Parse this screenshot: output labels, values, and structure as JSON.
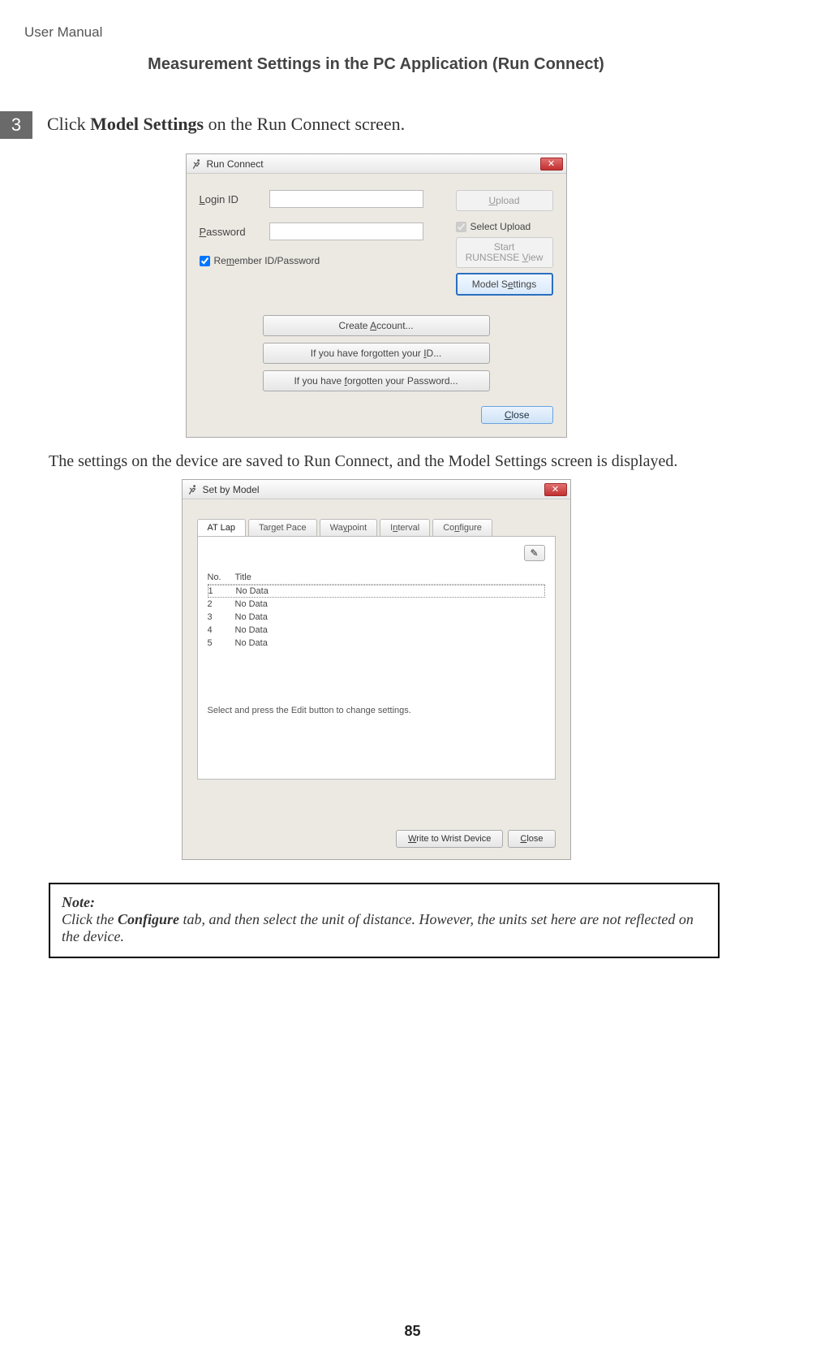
{
  "doc": {
    "header_small": "User Manual",
    "section_title": "Measurement Settings in the PC Application (Run Connect)",
    "step_number": "3",
    "step_prefix": "Click ",
    "step_bold": "Model Settings",
    "step_suffix": " on the Run Connect screen.",
    "body_text": "The settings on the device are saved to Run Connect, and the Model Settings screen is displayed.",
    "note_label": "Note:",
    "note_prefix": "Click the ",
    "note_bold": "Configure",
    "note_suffix": " tab, and then select the unit of distance. However, the units set here are not reflected on the device.",
    "page_number": "85"
  },
  "run_connect": {
    "title": "Run Connect",
    "login_label_u": "L",
    "login_label_rest": "ogin ID",
    "password_label_u": "P",
    "password_label_rest": "assword",
    "remember_pre": "Re",
    "remember_u": "m",
    "remember_post": "ember ID/Password",
    "upload_u": "U",
    "upload_rest": "pload",
    "select_upload": "Select Upload",
    "start_line1": "Start",
    "start_line2_pre": "RUNSENSE ",
    "start_line2_u": "V",
    "start_line2_post": "iew",
    "model_settings_pre": "Model S",
    "model_settings_u": "e",
    "model_settings_post": "ttings",
    "create_account_pre": "Create ",
    "create_account_u": "A",
    "create_account_post": "ccount...",
    "forgot_id_pre": "If you have forgotten your ",
    "forgot_id_u": "I",
    "forgot_id_post": "D...",
    "forgot_pw_pre": "If you have ",
    "forgot_pw_u": "f",
    "forgot_pw_post": "orgotten your Password...",
    "close_u": "C",
    "close_rest": "lose"
  },
  "set_by_model": {
    "title": "Set by Model",
    "tabs": {
      "at_lap": "AT Lap",
      "target_pace_pre": "Tar",
      "target_pace_u": "g",
      "target_pace_post": "et Pace",
      "waypoint_pre": "Wa",
      "waypoint_u": "y",
      "waypoint_post": "point",
      "interval_pre": "I",
      "interval_u": "n",
      "interval_post": "terval",
      "configure_pre": "Co",
      "configure_u": "n",
      "configure_post": "figure"
    },
    "col_no": "No.",
    "col_title": "Title",
    "rows": [
      {
        "no": "1",
        "title": "No Data"
      },
      {
        "no": "2",
        "title": "No Data"
      },
      {
        "no": "3",
        "title": "No Data"
      },
      {
        "no": "4",
        "title": "No Data"
      },
      {
        "no": "5",
        "title": "No Data"
      }
    ],
    "hint": "Select and press the Edit button to change settings.",
    "write_btn_u": "W",
    "write_btn_rest": "rite to Wrist Device",
    "close_u": "C",
    "close_rest": "lose",
    "pencil": "✎"
  }
}
